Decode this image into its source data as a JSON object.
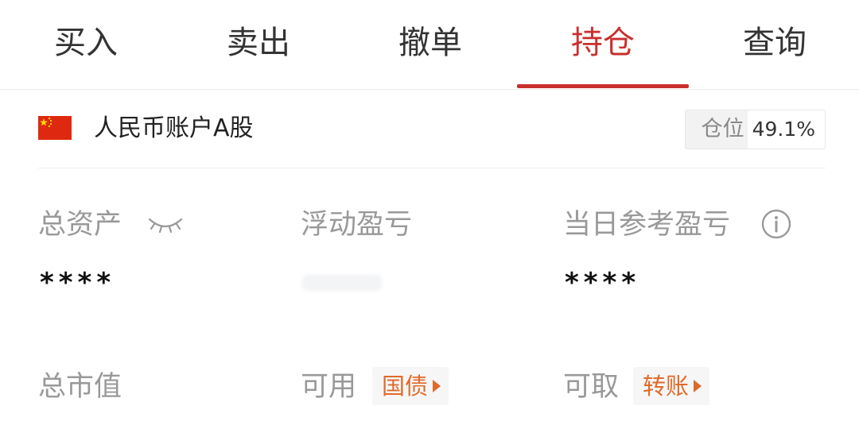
{
  "tabs": [
    {
      "label": "买入",
      "active": false
    },
    {
      "label": "卖出",
      "active": false
    },
    {
      "label": "撤单",
      "active": false
    },
    {
      "label": "持仓",
      "active": true
    },
    {
      "label": "查询",
      "active": false
    }
  ],
  "account": {
    "flag_icon": "china-flag-icon",
    "name": "人民币账户A股",
    "position_label": "仓位",
    "position_value": "49.1%"
  },
  "stats": {
    "total_assets": {
      "label": "总资产",
      "value": "****",
      "icon": "eye-closed-icon"
    },
    "floating_pnl": {
      "label": "浮动盈亏"
    },
    "daily_pnl": {
      "label": "当日参考盈亏",
      "value": "****",
      "icon": "info-icon"
    },
    "market_value": {
      "label": "总市值"
    },
    "available": {
      "label": "可用",
      "tag": "国债"
    },
    "withdrawable": {
      "label": "可取",
      "tag": "转账"
    }
  },
  "colors": {
    "accent": "#c8302e",
    "tag_text": "#e06a2a",
    "label_gray": "#999999"
  }
}
